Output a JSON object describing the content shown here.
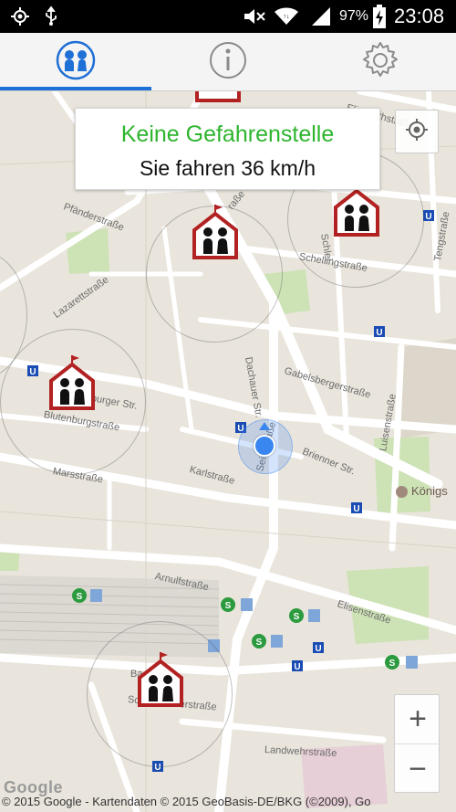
{
  "status_bar": {
    "icons": [
      "gps-icon",
      "usb-icon",
      "mute-icon",
      "wifi-icon",
      "signal-icon",
      "battery-charging-icon"
    ],
    "battery_text": "97%",
    "time": "23:08"
  },
  "tabs": [
    {
      "icon": "children-icon",
      "active": true
    },
    {
      "icon": "info-icon",
      "active": false
    },
    {
      "icon": "gear-icon",
      "active": false
    }
  ],
  "info_box": {
    "status": "Keine Gefahrenstelle",
    "speed": "Sie fahren 36 km/h"
  },
  "colors": {
    "status_green": "#2db52d",
    "tab_indicator": "#1e6fd6",
    "location_dot": "#3a86f0",
    "school_marker": "#b22222"
  },
  "streets": {
    "elisabeth": "Elisabethstraße",
    "pfaender": "Pfänderstraße",
    "schelling": "Schellingstraße",
    "lazarett": "Lazarettstraße",
    "gabelsberger": "Gabelsbergerstraße",
    "dachauer": "Dachauer Str.",
    "luisen": "Luisenstraße",
    "burger": "burger Str.",
    "blutenburg": "Blutenburgstraße",
    "brienner": "Brienner Str.",
    "karl": "Karlstraße",
    "mars": "Marsstraße",
    "seidl": "Seidlstraße",
    "arnulf": "Arnulfstraße",
    "elisen": "Elisenstraße",
    "schwanthaler": "Schwanthalerstraße",
    "landwehr": "Landwehrstraße",
    "tengstr": "Tengstraße",
    "schlei": "Schlei",
    "rasse": "raße",
    "ba": "Ba"
  },
  "poi": {
    "koenigsplatz": "Königs"
  },
  "map_controls": {
    "zoom_in": "+",
    "zoom_out": "−"
  },
  "footer": {
    "google_logo": "Google",
    "copyright": "© 2015 Google - Kartendaten © 2015 GeoBasis-DE/BKG (©2009), Go"
  }
}
